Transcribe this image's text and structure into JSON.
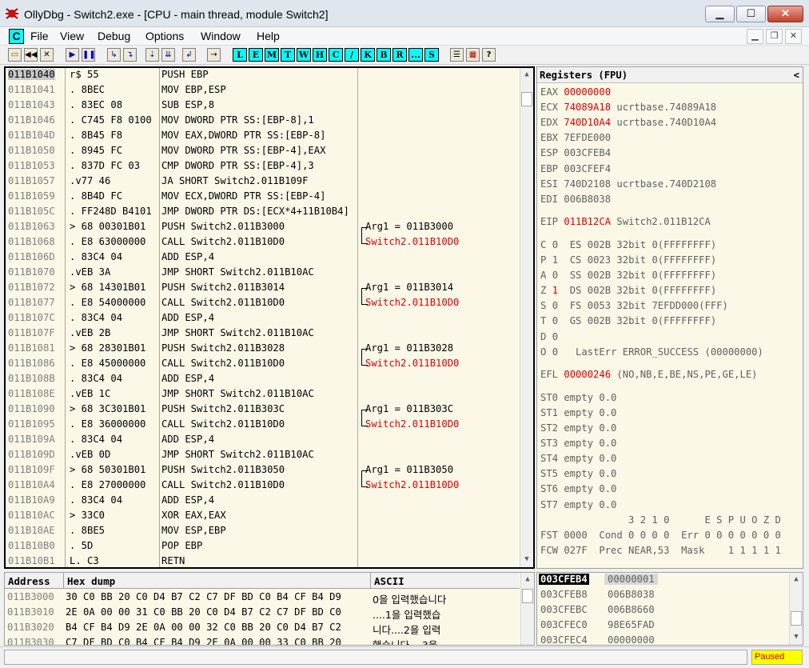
{
  "window": {
    "title": "OllyDbg - Switch2.exe - [CPU - main thread, module Switch2]",
    "min_label": "▁",
    "max_label": "☐",
    "close_label": "✕"
  },
  "menu": {
    "cpu_badge": "C",
    "items": [
      "File",
      "View",
      "Debug",
      "Options",
      "Window",
      "Help"
    ],
    "mdi_min": "▁",
    "mdi_restore": "❐",
    "mdi_close": "✕"
  },
  "toolbar": {
    "icons": [
      "open-icon",
      "rewind-icon",
      "close-icon",
      "run-icon",
      "pause-icon",
      "step-into-icon",
      "step-over-icon",
      "trace-into-icon",
      "trace-over-icon",
      "execute-till-return-icon",
      "go-to-icon"
    ],
    "letters": [
      "L",
      "E",
      "M",
      "T",
      "W",
      "H",
      "C",
      "/",
      "K",
      "B",
      "R",
      "...",
      "S"
    ],
    "right_icons": [
      "list-icon",
      "grid-icon",
      "help-icon"
    ],
    "help_label": "?"
  },
  "disasm": {
    "rows": [
      {
        "addr": "011B1040",
        "hex": "r$ 55",
        "mnem": "PUSH EBP",
        "cmt": ""
      },
      {
        "addr": "011B1041",
        "hex": ". 8BEC",
        "mnem": "MOV EBP,ESP",
        "cmt": ""
      },
      {
        "addr": "011B1043",
        "hex": ". 83EC 08",
        "mnem": "SUB ESP,8",
        "cmt": ""
      },
      {
        "addr": "011B1046",
        "hex": ". C745 F8 0100",
        "mnem": "MOV DWORD PTR SS:[EBP-8],1",
        "cmt": ""
      },
      {
        "addr": "011B104D",
        "hex": ". 8B45 F8",
        "mnem": "MOV EAX,DWORD PTR SS:[EBP-8]",
        "cmt": ""
      },
      {
        "addr": "011B1050",
        "hex": ". 8945 FC",
        "mnem": "MOV DWORD PTR SS:[EBP-4],EAX",
        "cmt": ""
      },
      {
        "addr": "011B1053",
        "hex": ". 837D FC 03",
        "mnem": "CMP DWORD PTR SS:[EBP-4],3",
        "cmt": ""
      },
      {
        "addr": "011B1057",
        "hex": ".v77 46",
        "mnem": "JA SHORT Switch2.011B109F",
        "cmt": ""
      },
      {
        "addr": "011B1059",
        "hex": ". 8B4D FC",
        "mnem": "MOV ECX,DWORD PTR SS:[EBP-4]",
        "cmt": ""
      },
      {
        "addr": "011B105C",
        "hex": ". FF248D B4101",
        "mnem": "JMP DWORD PTR DS:[ECX*4+11B10B4]",
        "cmt": ""
      },
      {
        "addr": "011B1063",
        "hex": "> 68 00301B01",
        "mnem": "PUSH Switch2.011B3000",
        "cmt": "Arg1 = 011B3000"
      },
      {
        "addr": "011B1068",
        "hex": ". E8 63000000",
        "mnem": "CALL Switch2.011B10D0",
        "cmt": "Switch2.011B10D0"
      },
      {
        "addr": "011B106D",
        "hex": ". 83C4 04",
        "mnem": "ADD ESP,4",
        "cmt": ""
      },
      {
        "addr": "011B1070",
        "hex": ".vEB 3A",
        "mnem": "JMP SHORT Switch2.011B10AC",
        "cmt": ""
      },
      {
        "addr": "011B1072",
        "hex": "> 68 14301B01",
        "mnem": "PUSH Switch2.011B3014",
        "cmt": "Arg1 = 011B3014"
      },
      {
        "addr": "011B1077",
        "hex": ". E8 54000000",
        "mnem": "CALL Switch2.011B10D0",
        "cmt": "Switch2.011B10D0"
      },
      {
        "addr": "011B107C",
        "hex": ". 83C4 04",
        "mnem": "ADD ESP,4",
        "cmt": ""
      },
      {
        "addr": "011B107F",
        "hex": ".vEB 2B",
        "mnem": "JMP SHORT Switch2.011B10AC",
        "cmt": ""
      },
      {
        "addr": "011B1081",
        "hex": "> 68 28301B01",
        "mnem": "PUSH Switch2.011B3028",
        "cmt": "Arg1 = 011B3028"
      },
      {
        "addr": "011B1086",
        "hex": ". E8 45000000",
        "mnem": "CALL Switch2.011B10D0",
        "cmt": "Switch2.011B10D0"
      },
      {
        "addr": "011B108B",
        "hex": ". 83C4 04",
        "mnem": "ADD ESP,4",
        "cmt": ""
      },
      {
        "addr": "011B108E",
        "hex": ".vEB 1C",
        "mnem": "JMP SHORT Switch2.011B10AC",
        "cmt": ""
      },
      {
        "addr": "011B1090",
        "hex": "> 68 3C301B01",
        "mnem": "PUSH Switch2.011B303C",
        "cmt": "Arg1 = 011B303C"
      },
      {
        "addr": "011B1095",
        "hex": ". E8 36000000",
        "mnem": "CALL Switch2.011B10D0",
        "cmt": "Switch2.011B10D0"
      },
      {
        "addr": "011B109A",
        "hex": ". 83C4 04",
        "mnem": "ADD ESP,4",
        "cmt": ""
      },
      {
        "addr": "011B109D",
        "hex": ".vEB 0D",
        "mnem": "JMP SHORT Switch2.011B10AC",
        "cmt": ""
      },
      {
        "addr": "011B109F",
        "hex": "> 68 50301B01",
        "mnem": "PUSH Switch2.011B3050",
        "cmt": "Arg1 = 011B3050"
      },
      {
        "addr": "011B10A4",
        "hex": ". E8 27000000",
        "mnem": "CALL Switch2.011B10D0",
        "cmt": "Switch2.011B10D0"
      },
      {
        "addr": "011B10A9",
        "hex": ". 83C4 04",
        "mnem": "ADD ESP,4",
        "cmt": ""
      },
      {
        "addr": "011B10AC",
        "hex": "> 33C0",
        "mnem": "XOR EAX,EAX",
        "cmt": ""
      },
      {
        "addr": "011B10AE",
        "hex": ". 8BE5",
        "mnem": "MOV ESP,EBP",
        "cmt": ""
      },
      {
        "addr": "011B10B0",
        "hex": ". 5D",
        "mnem": "POP EBP",
        "cmt": ""
      },
      {
        "addr": "011B10B1",
        "hex": "L. C3",
        "mnem": "RETN",
        "cmt": ""
      }
    ]
  },
  "registers": {
    "title": "Registers (FPU)",
    "collapse": "<",
    "gp": [
      {
        "name": "EAX",
        "val": "00000000",
        "red": true,
        "cmt": ""
      },
      {
        "name": "ECX",
        "val": "74089A18",
        "red": true,
        "cmt": "ucrtbase.74089A18"
      },
      {
        "name": "EDX",
        "val": "740D10A4",
        "red": true,
        "cmt": "ucrtbase.740D10A4"
      },
      {
        "name": "EBX",
        "val": "7EFDE000",
        "red": false,
        "cmt": ""
      },
      {
        "name": "ESP",
        "val": "003CFEB4",
        "red": false,
        "cmt": ""
      },
      {
        "name": "EBP",
        "val": "003CFEF4",
        "red": false,
        "cmt": ""
      },
      {
        "name": "ESI",
        "val": "740D2108",
        "red": false,
        "cmt": "ucrtbase.740D2108"
      },
      {
        "name": "EDI",
        "val": "006B8038",
        "red": false,
        "cmt": ""
      }
    ],
    "eip": {
      "name": "EIP",
      "val": "011B12CA",
      "cmt": "Switch2.011B12CA"
    },
    "flags": [
      {
        "f": "C",
        "v": "0",
        "red": false,
        "seg": "ES 002B 32bit 0(FFFFFFFF)"
      },
      {
        "f": "P",
        "v": "1",
        "red": false,
        "seg": "CS 0023 32bit 0(FFFFFFFF)"
      },
      {
        "f": "A",
        "v": "0",
        "red": false,
        "seg": "SS 002B 32bit 0(FFFFFFFF)"
      },
      {
        "f": "Z",
        "v": "1",
        "red": true,
        "seg": "DS 002B 32bit 0(FFFFFFFF)"
      },
      {
        "f": "S",
        "v": "0",
        "red": false,
        "seg": "FS 0053 32bit 7EFDD000(FFF)"
      },
      {
        "f": "T",
        "v": "0",
        "red": false,
        "seg": "GS 002B 32bit 0(FFFFFFFF)"
      },
      {
        "f": "D",
        "v": "0",
        "red": false,
        "seg": ""
      },
      {
        "f": "O",
        "v": "0",
        "red": false,
        "seg": " LastErr ERROR_SUCCESS (00000000)"
      }
    ],
    "efl": {
      "name": "EFL",
      "val": "00000246",
      "cmt": "(NO,NB,E,BE,NS,PE,GE,LE)"
    },
    "st": [
      "ST0 empty 0.0",
      "ST1 empty 0.0",
      "ST2 empty 0.0",
      "ST3 empty 0.0",
      "ST4 empty 0.0",
      "ST5 empty 0.0",
      "ST6 empty 0.0",
      "ST7 empty 0.0"
    ],
    "fpu_hdr": "               3 2 1 0      E S P U O Z D",
    "fst": "FST 0000  Cond 0 0 0 0  Err 0 0 0 0 0 0 0",
    "fcw": "FCW 027F  Prec NEAR,53  Mask    1 1 1 1 1"
  },
  "dump": {
    "headers": [
      "Address",
      "Hex dump",
      "ASCII"
    ],
    "rows": [
      {
        "addr": "011B3000",
        "hex": "30 C0 BB 20 C0 D4 B7 C2 C7 DF BD C0 B4 CF B4 D9",
        "ascii": "0을 입력했습니다"
      },
      {
        "addr": "011B3010",
        "hex": "2E 0A 00 00 31 C0 BB 20 C0 D4 B7 C2 C7 DF BD C0",
        "ascii": "....1을 입력했습"
      },
      {
        "addr": "011B3020",
        "hex": "B4 CF B4 D9 2E 0A 00 00 32 C0 BB 20 C0 D4 B7 C2",
        "ascii": "니다....2을 입력"
      },
      {
        "addr": "011B3030",
        "hex": "C7 DF BD C0 B4 CF B4 D9 2E 0A 00 00 33 C0 BB 20",
        "ascii": "했습니다....3을 "
      }
    ]
  },
  "stack": {
    "rows": [
      {
        "addr": "003CFEB4",
        "val": "00000001",
        "selected": true
      },
      {
        "addr": "003CFEB8",
        "val": "006B8038",
        "selected": false
      },
      {
        "addr": "003CFEBC",
        "val": "006B8660",
        "selected": false
      },
      {
        "addr": "003CFEC0",
        "val": "98E65FAD",
        "selected": false
      },
      {
        "addr": "003CFEC4",
        "val": "00000000",
        "selected": false
      }
    ]
  },
  "status": {
    "message": "",
    "state": "Paused"
  }
}
